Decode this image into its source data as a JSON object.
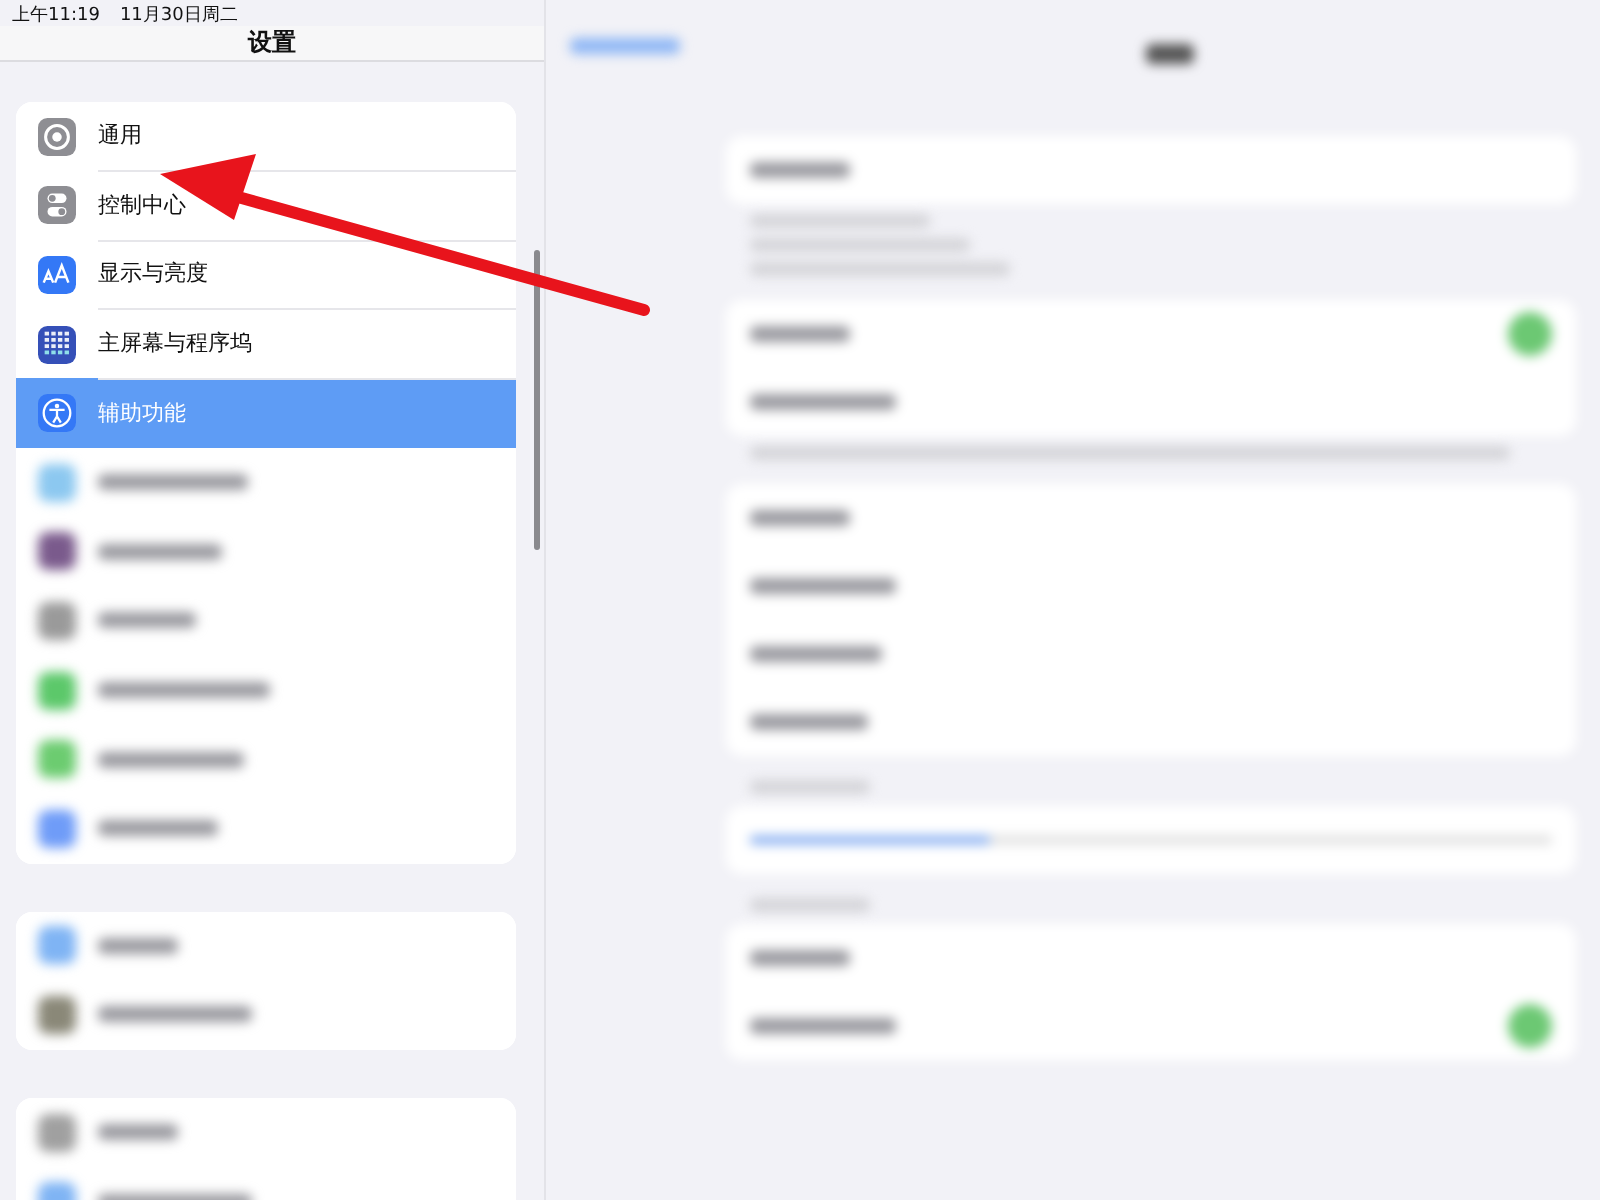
{
  "status_bar": {
    "time": "上午11:19",
    "date": "11月30日周二"
  },
  "sidebar": {
    "title": "设置",
    "groups": [
      {
        "items": [
          {
            "kind": "labeled",
            "label": "通用",
            "selected": false
          },
          {
            "kind": "labeled",
            "label": "控制中心",
            "selected": false
          },
          {
            "kind": "labeled",
            "label": "显示与亮度",
            "selected": false
          },
          {
            "kind": "labeled",
            "label": "主屏幕与程序坞",
            "selected": false
          },
          {
            "kind": "labeled",
            "label": "辅助功能",
            "selected": true
          },
          {
            "kind": "blurred",
            "color": "#8cc8f0",
            "selected": false
          },
          {
            "kind": "blurred",
            "color": "#7a5a8c",
            "selected": false
          },
          {
            "kind": "blurred",
            "color": "#9a9a9a",
            "selected": false
          },
          {
            "kind": "blurred",
            "color": "#5cc86a",
            "selected": false
          },
          {
            "kind": "blurred",
            "color": "#6ccc70",
            "selected": false
          },
          {
            "kind": "blurred",
            "color": "#6f9cf8",
            "selected": false
          }
        ]
      },
      {
        "items": [
          {
            "kind": "blurred",
            "color": "#7fb4f4",
            "selected": false
          },
          {
            "kind": "blurred",
            "color": "#8a8878",
            "selected": false
          }
        ]
      },
      {
        "items": [
          {
            "kind": "blurred",
            "color": "#a0a0a0",
            "selected": false
          },
          {
            "kind": "blurred",
            "color": "#7fb4f4",
            "selected": false
          }
        ]
      }
    ]
  }
}
